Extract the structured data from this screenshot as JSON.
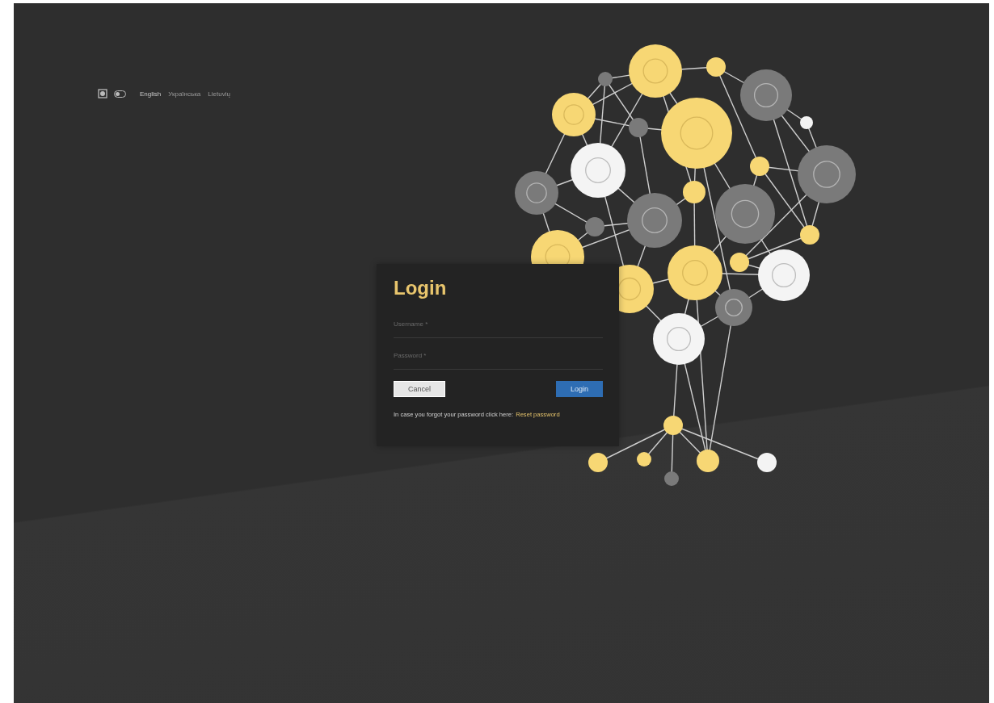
{
  "theme_toggle": {
    "on": false
  },
  "languages": [
    {
      "label": "English",
      "selected": true
    },
    {
      "label": "Українська",
      "selected": false
    },
    {
      "label": "Lietuvių",
      "selected": false
    }
  ],
  "login": {
    "title": "Login",
    "fields": [
      {
        "placeholder": "Username *"
      },
      {
        "placeholder": "Password *"
      }
    ],
    "cancel_button": "Cancel",
    "login_button": "Login",
    "help_text": "In case you forgot your password click here:",
    "reset_link": "Reset password"
  }
}
